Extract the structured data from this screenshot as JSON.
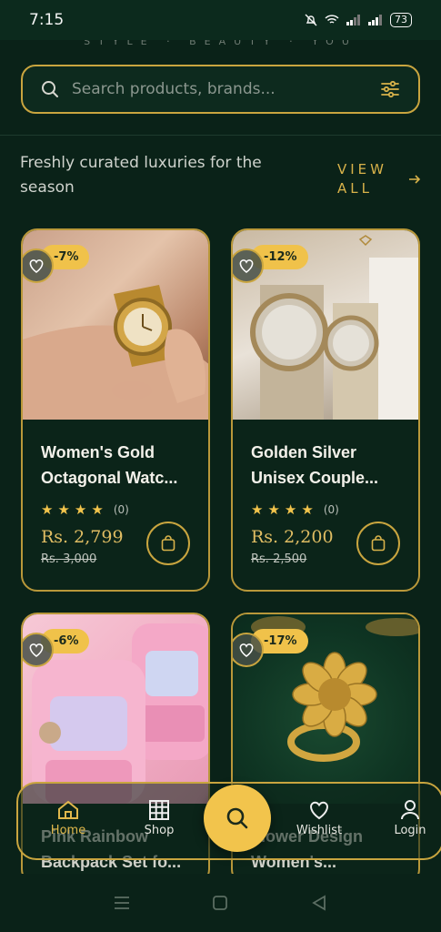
{
  "status": {
    "time": "7:15",
    "battery": "73"
  },
  "brand": {
    "tagline": "STYLE · BEAUTY · YOU"
  },
  "search": {
    "placeholder": "Search products, brands..."
  },
  "section": {
    "title": "Freshly curated luxuries for the season",
    "view_all": "VIEW ALL"
  },
  "products": [
    {
      "discount": "-7%",
      "title": "Women's Gold Octagonal Watc...",
      "rating_count": "(0)",
      "price": "Rs. 2,799",
      "old_price": "Rs. 3,000"
    },
    {
      "discount": "-12%",
      "title": "Golden Silver Unisex Couple...",
      "rating_count": "(0)",
      "price": "Rs. 2,200",
      "old_price": "Rs. 2,500"
    },
    {
      "discount": "-6%",
      "title": "Pink Rainbow Backpack Set fo..."
    },
    {
      "discount": "-17%",
      "title": "Flower Design Women's..."
    }
  ],
  "nav": {
    "home": "Home",
    "shop": "Shop",
    "wishlist": "Wishlist",
    "login": "Login"
  },
  "colors": {
    "accent": "#c9a53f",
    "gold": "#f2c44c",
    "background": "#0a2218"
  }
}
